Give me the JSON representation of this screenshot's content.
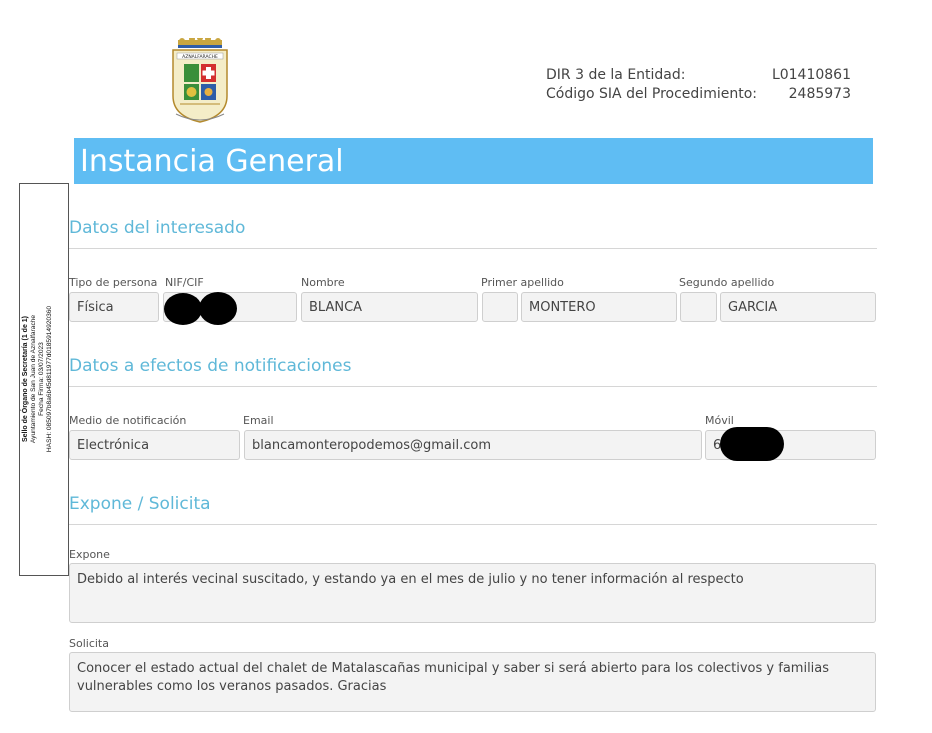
{
  "header": {
    "dir3_label": "DIR 3 de la Entidad:",
    "dir3_value": "L01410861",
    "sia_label": "Código SIA del Procedimiento:",
    "sia_value": "2485973",
    "logo_text": "AZNALFARACHE"
  },
  "title": "Instancia General",
  "stamp": {
    "line1": "Sello de Órgano de Secretaría (1 de 1)",
    "line2": "Ayuntamiento de San Juan de Aznalfarache",
    "line3": "Fecha Firma: 03/07/2023",
    "line4": "HASH: 085097b8a6b45d811977d0185914920360"
  },
  "interesado": {
    "section_title": "Datos del interesado",
    "tipo_label": "Tipo de persona",
    "tipo_value": "Física",
    "nif_label": "NIF/CIF",
    "nombre_label": "Nombre",
    "nombre_value": "BLANCA",
    "apellido1_label": "Primer apellido",
    "apellido1_value": "MONTERO",
    "apellido2_label": "Segundo apellido",
    "apellido2_value": "GARCIA"
  },
  "notificaciones": {
    "section_title": "Datos a efectos de notificaciones",
    "medio_label": "Medio de notificación",
    "medio_value": "Electrónica",
    "email_label": "Email",
    "email_value": "blancamonteropodemos@gmail.com",
    "movil_label": "Móvil",
    "movil_value": "6"
  },
  "expone_solicita": {
    "section_title": "Expone / Solicita",
    "expone_label": "Expone",
    "expone_value": "Debido al interés vecinal suscitado, y estando ya en el mes de julio y no tener información al respecto",
    "solicita_label": "Solicita",
    "solicita_value": "Conocer el estado actual del chalet de Matalascañas municipal y saber si será abierto para los colectivos y familias vulnerables como los veranos pasados. Gracias"
  }
}
